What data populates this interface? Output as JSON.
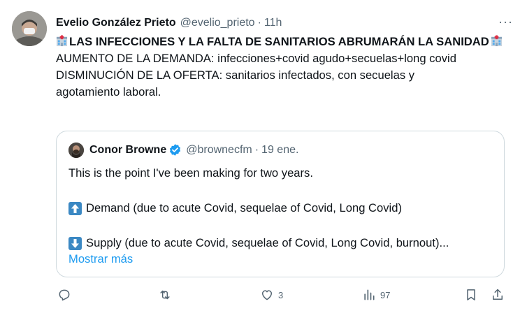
{
  "tweet": {
    "author_name": "Evelio González Prieto",
    "handle": "@evelio_prieto",
    "separator": "·",
    "time": "11h",
    "more": "···",
    "headline": "LAS INFECCIONES Y LA FALTA DE SANITARIOS ABRUMARÁN LA SANIDAD",
    "body_line1": "AUMENTO DE LA DEMANDA: infecciones+covid agudo+secuelas+long covid",
    "body_line2": "DISMINUCIÓN DE LA OFERTA: sanitarios infectados, con secuelas y",
    "body_line3": "agotamiento laboral.",
    "headline_icon": "hospital-emoji-icon"
  },
  "quoted": {
    "author_name": "Conor Browne",
    "handle": "@brownecfm",
    "separator": "·",
    "date": "19 ene.",
    "line1": "This is the point I've been making for two years.",
    "line2": "Demand (due to acute Covid, sequelae of Covid, Long Covid)",
    "line3": "Supply (due to acute Covid, sequelae of Covid, Long Covid, burnout)...",
    "show_more": "Mostrar más",
    "verified_color": "#1d9bf0"
  },
  "actions": {
    "reply_count": "",
    "retweet_count": "",
    "like_count": "3",
    "views_count": "97"
  },
  "colors": {
    "text": "#0f1419",
    "secondary": "#536471",
    "link": "#1d9bf0",
    "border": "#cfd9de"
  }
}
